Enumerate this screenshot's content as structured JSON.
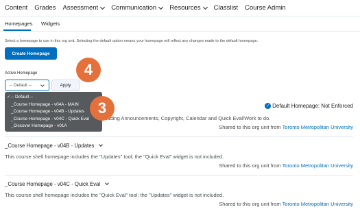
{
  "nav": {
    "items": [
      {
        "label": "Content",
        "has_menu": false
      },
      {
        "label": "Grades",
        "has_menu": false
      },
      {
        "label": "Assessment",
        "has_menu": true
      },
      {
        "label": "Communication",
        "has_menu": true
      },
      {
        "label": "Resources",
        "has_menu": true
      },
      {
        "label": "Classlist",
        "has_menu": false
      },
      {
        "label": "Course Admin",
        "has_menu": false
      }
    ]
  },
  "tabs": {
    "homepages": "Homepages",
    "widgets": "Widgets",
    "active": "Homepages"
  },
  "description": "Select a homepage to use in this org unit. Selecting the default option means your homepage will reflect any changes made to the default homepage.",
  "create_button": "Create Homepage",
  "callouts": {
    "step_a": "4",
    "step_b": "3",
    "color": "#e4713c"
  },
  "active_homepage": {
    "label": "Active Homepage",
    "selected": "-- Default --",
    "apply_label": "Apply",
    "options": [
      {
        "label": "-- Default --",
        "checked": true
      },
      {
        "label": "_Course Homepage - v04A - MAIN",
        "checked": false
      },
      {
        "label": "_Course Homepage - v04B - Updates",
        "checked": false
      },
      {
        "label": "_Course Homepage - v04C - Quick Eval",
        "checked": false
      },
      {
        "label": "_Discover Homepage - v01A",
        "checked": false
      }
    ]
  },
  "default_status": "Default Homepage: Not Enforced",
  "homepages": [
    {
      "title": "",
      "description_tail": "cluding Announcements, Copyright, Calendar and Quick Eval/Work to do.",
      "shared_prefix": "Shared to this org unit from",
      "shared_org": "Toronto Metropolitan University"
    },
    {
      "title": "_Course Homepage - v04B - Updates",
      "description": "This course shell homepage includes the \"Updates\" tool; the \"Quick Eval\" widget is not included.",
      "shared_prefix": "Shared to this org unit from",
      "shared_org": "Toronto Metropolitan University"
    },
    {
      "title": "_Course Homepage - v04C - Quick Eval",
      "description": "This course shell homepage includes the \"Quick Eval\" tool; the \"Updates\" widget is not included.",
      "shared_prefix": "Shared to this org unit from",
      "shared_org": "Toronto Metropolitan University"
    }
  ],
  "colors": {
    "accent": "#006fbf",
    "dropdown_bg": "#565a5c",
    "divider": "#e3e9f1"
  }
}
